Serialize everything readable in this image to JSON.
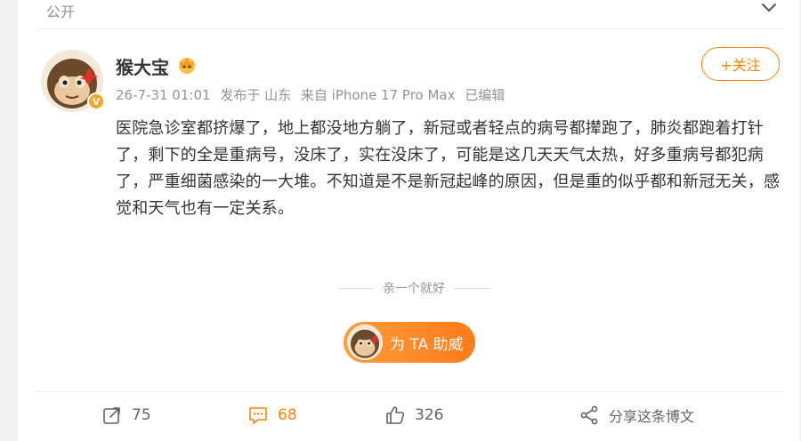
{
  "header": {
    "visibility_label": "公开",
    "chevron_icon": "chevron-down-icon"
  },
  "post": {
    "username": "猴大宝",
    "badge_icon": "crown-badge-icon",
    "verified_icon": "verified-v-icon",
    "verified_letter": "V",
    "follow_label": "+关注",
    "meta": {
      "time": "26-7-31 01:01",
      "location": "发布于 山东",
      "device": "来自 iPhone 17 Pro Max",
      "edited": "已编辑"
    },
    "content": "医院急诊室都挤爆了，地上都没地方躺了，新冠或者轻点的病号都撵跑了，肺炎都跑着打针了，剩下的全是重病号，没床了，实在没床了，可能是这几天天气太热，好多重病号都犯病了，严重细菌感染的一大堆。不知道是不是新冠起峰的原因，但是重的似乎都和新冠无关，感觉和天气也有一定关系。"
  },
  "kiss": {
    "label": "亲一个就好"
  },
  "boost": {
    "label": "为 TA 助威"
  },
  "actions": {
    "forward": {
      "count": "75",
      "icon": "forward-icon"
    },
    "comment": {
      "count": "68",
      "icon": "comment-icon"
    },
    "like": {
      "count": "326",
      "icon": "thumbs-up-icon"
    },
    "share": {
      "label": "分享这条博文",
      "icon": "share-icon"
    }
  },
  "colors": {
    "accent": "#ff8200",
    "muted": "#939393",
    "text": "#333333"
  }
}
